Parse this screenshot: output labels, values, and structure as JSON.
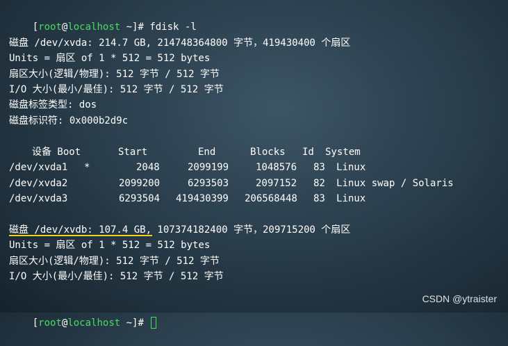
{
  "prompt1": {
    "lb": "[",
    "user": "root",
    "at": "@",
    "host": "localhost",
    "rest": " ~]# ",
    "cmd": "fdisk -l"
  },
  "disk1": {
    "header": "磁盘 /dev/xvda: 214.7 GB, 214748364800 字节，419430400 个扇区",
    "units": "Units = 扇区 of 1 * 512 = 512 bytes",
    "sector_size": "扇区大小(逻辑/物理): 512 字节 / 512 字节",
    "io_size": "I/O 大小(最小/最佳): 512 字节 / 512 字节",
    "label_type": "磁盘标签类型: dos",
    "identifier": "磁盘标识符: 0x000b2d9c"
  },
  "table": {
    "headers": {
      "device": "设备 Boot",
      "start": "Start",
      "end": "End",
      "blocks": "Blocks",
      "id": "Id",
      "system": "System"
    },
    "rows": [
      {
        "device": "/dev/xvda1",
        "boot": "*",
        "start": "2048",
        "end": "2099199",
        "blocks": "1048576",
        "id": "83",
        "system": "Linux"
      },
      {
        "device": "/dev/xvda2",
        "boot": "",
        "start": "2099200",
        "end": "6293503",
        "blocks": "2097152",
        "id": "82",
        "system": "Linux swap / Solaris"
      },
      {
        "device": "/dev/xvda3",
        "boot": "",
        "start": "6293504",
        "end": "419430399",
        "blocks": "206568448",
        "id": "83",
        "system": "Linux"
      }
    ]
  },
  "disk2": {
    "header": "磁盘 /dev/xvdb: 107.4 GB, 107374182400 字节，209715200 个扇区",
    "units": "Units = 扇区 of 1 * 512 = 512 bytes",
    "sector_size": "扇区大小(逻辑/物理): 512 字节 / 512 字节",
    "io_size": "I/O 大小(最小/最佳): 512 字节 / 512 字节"
  },
  "prompt2": {
    "lb": "[",
    "user": "root",
    "at": "@",
    "host": "localhost",
    "rest": " ~]# "
  },
  "watermark": "CSDN @ytraister",
  "colors": {
    "prompt_green": "#4cd964",
    "highlight_underline": "#f2d21b"
  }
}
